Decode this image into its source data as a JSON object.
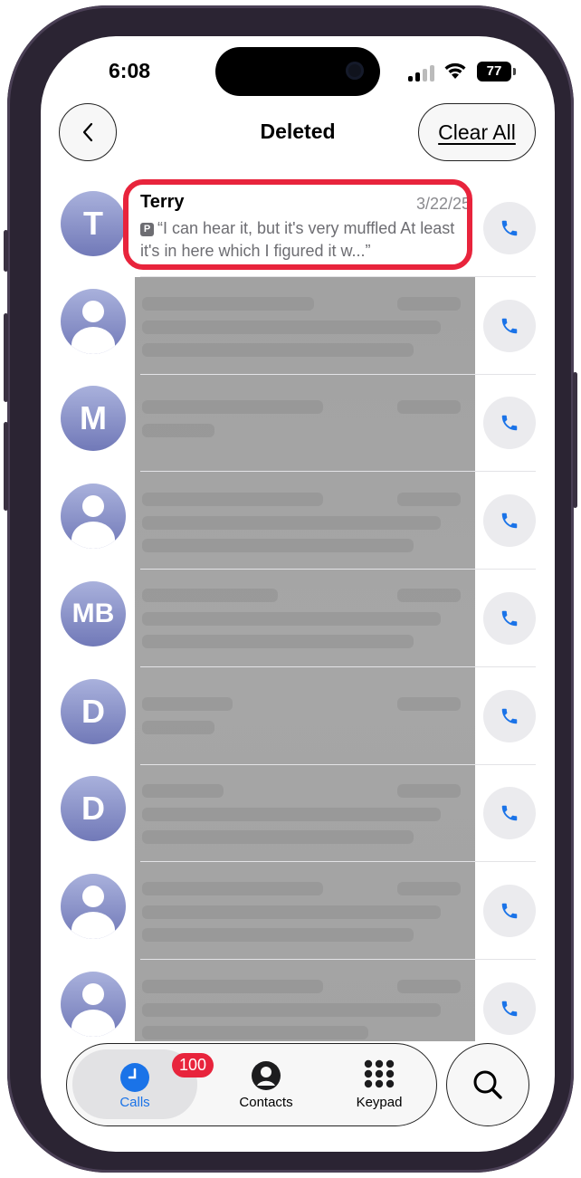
{
  "status": {
    "time": "6:08",
    "battery": "77"
  },
  "header": {
    "title": "Deleted",
    "clear_label": "Clear All"
  },
  "calls": [
    {
      "initials": "T",
      "name": "Terry",
      "date": "3/22/25",
      "preview": "“I can hear it, but it's very muffled At least it's in here which I figured it w...”",
      "has_voicemail_badge": true,
      "highlighted": true
    },
    {
      "initials": "",
      "contact_icon": "person-icon"
    },
    {
      "initials": "M"
    },
    {
      "initials": "",
      "contact_icon": "person-icon"
    },
    {
      "initials": "MB"
    },
    {
      "initials": "D"
    },
    {
      "initials": "D"
    },
    {
      "initials": "",
      "contact_icon": "person-icon"
    },
    {
      "initials": "",
      "contact_icon": "person-icon"
    }
  ],
  "tabs": [
    {
      "label": "Calls",
      "icon": "clock-icon",
      "badge": "100",
      "active": true
    },
    {
      "label": "Contacts",
      "icon": "person-circle-icon"
    },
    {
      "label": "Keypad",
      "icon": "keypad-icon"
    }
  ],
  "colors": {
    "accent": "#1a73e8",
    "highlight": "#e8243c",
    "avatar": "#8a92c8"
  }
}
